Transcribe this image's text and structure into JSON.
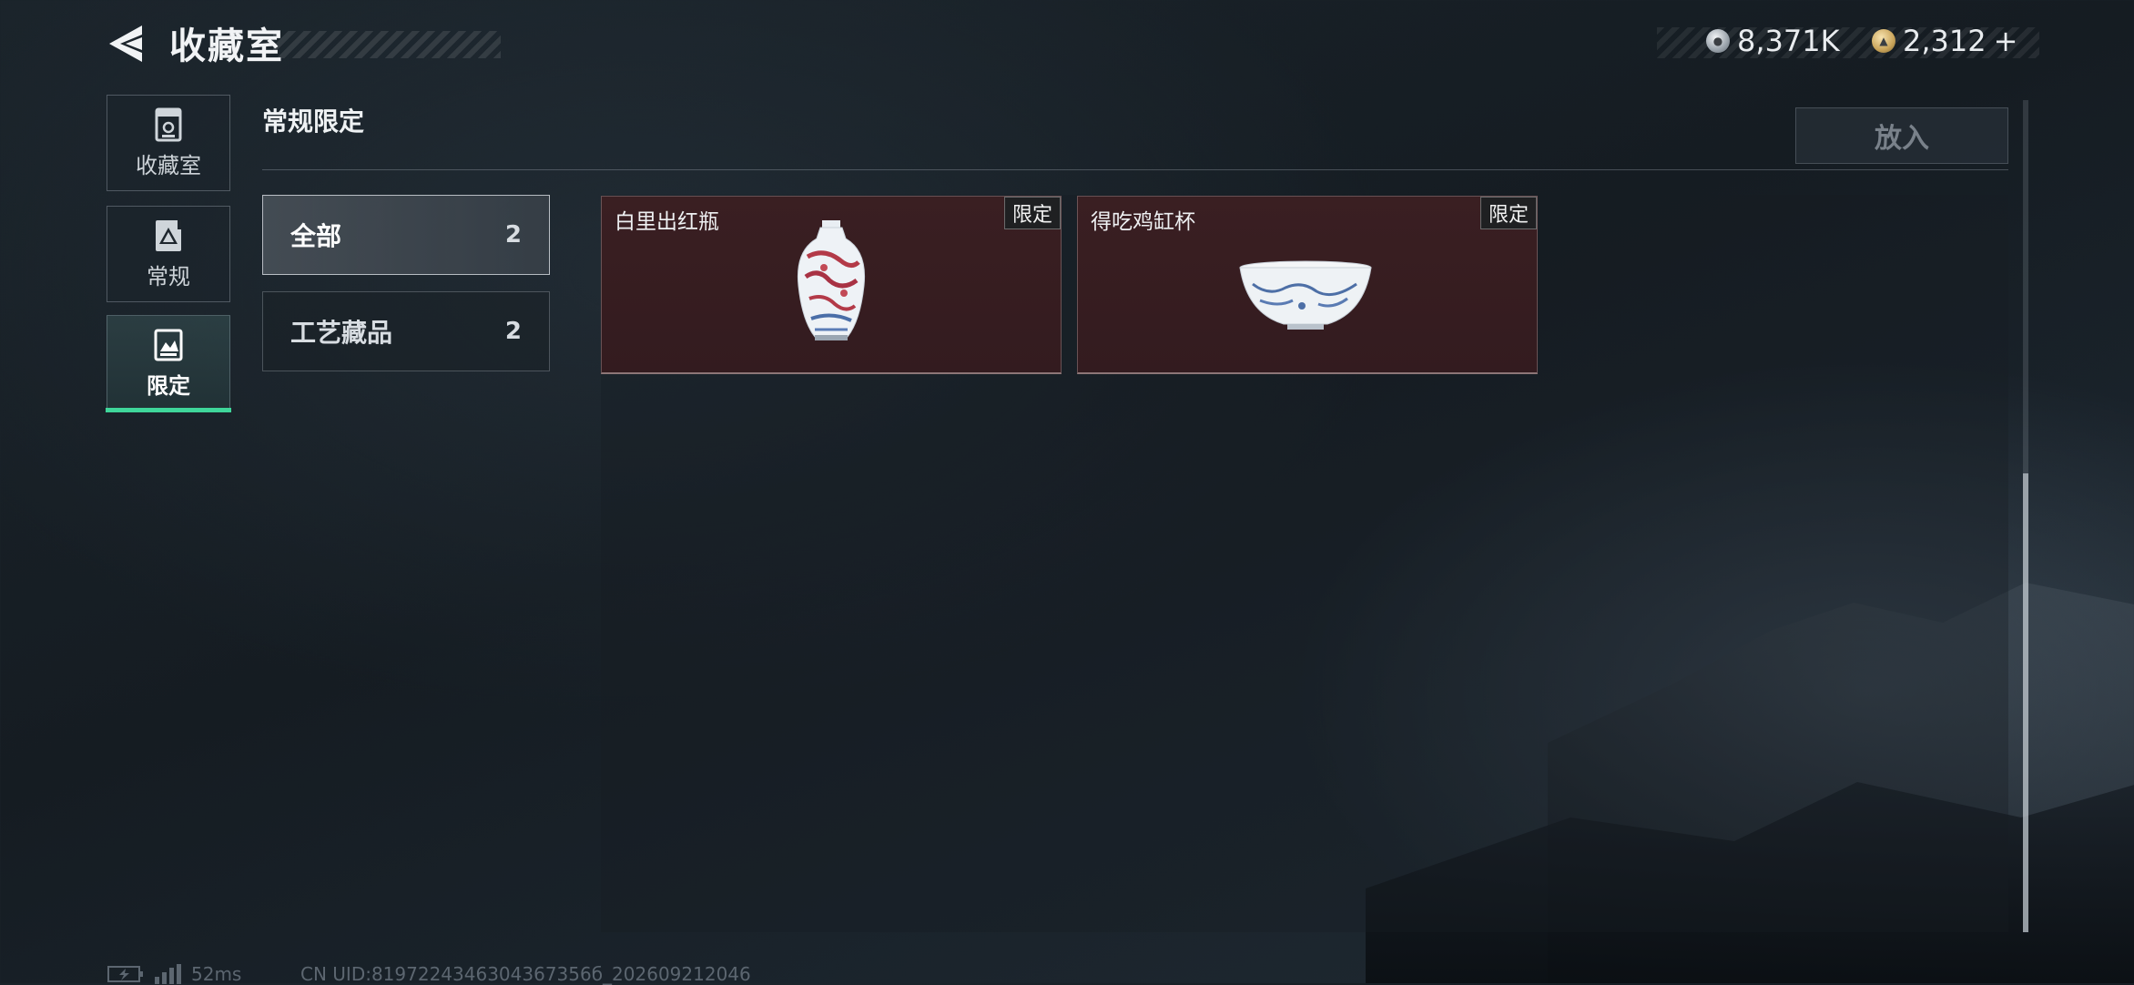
{
  "header": {
    "title": "收藏室",
    "currency_silver": "8,371K",
    "currency_gold": "2,312",
    "add_currency_symbol": "+"
  },
  "nav": [
    {
      "label": "收藏室",
      "icon": "collection-room-icon"
    },
    {
      "label": "常规",
      "icon": "regular-icon"
    },
    {
      "label": "限定",
      "icon": "limited-icon"
    }
  ],
  "section": {
    "title": "常规限定",
    "put_in_label": "放入"
  },
  "categories": [
    {
      "label": "全部",
      "count": "2"
    },
    {
      "label": "工艺藏品",
      "count": "2"
    }
  ],
  "items": [
    {
      "name": "白里出红瓶",
      "badge": "限定"
    },
    {
      "name": "得吃鸡缸杯",
      "badge": "限定"
    }
  ],
  "status": {
    "ping": "52ms",
    "uid": "CN UID:8197224346304367356б_202609212046"
  },
  "colors": {
    "accent_green": "#3fd69a",
    "item_card_bg": "#3a1f22",
    "background": "#1b242b"
  }
}
